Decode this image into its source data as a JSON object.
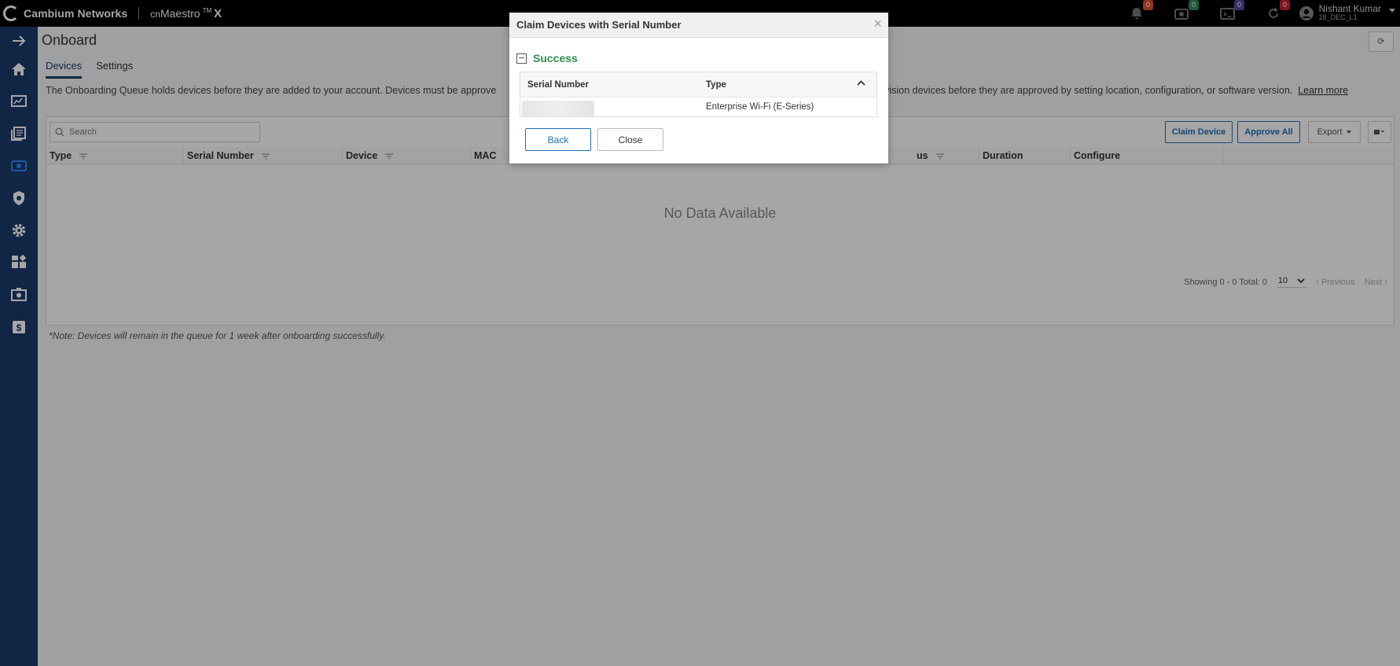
{
  "topbar": {
    "brand": "Cambium Networks",
    "product_prefix": "cn",
    "product_name": "Maestro",
    "product_tm": "TM",
    "product_suffix": "X",
    "badges": [
      {
        "icon": "alarm-bell-icon",
        "count": "0",
        "color": "#e0522e"
      },
      {
        "icon": "devices-icon",
        "count": "0",
        "color": "#2e8b57"
      },
      {
        "icon": "terminal-icon",
        "count": "0",
        "color": "#5b4aa8"
      },
      {
        "icon": "sync-icon",
        "count": "0",
        "color": "#c82333"
      }
    ],
    "user_name": "Nishant Kumar",
    "user_org": "18_DEC_L1"
  },
  "sidebar": {
    "items": [
      {
        "name": "expand-arrow",
        "icon": "arrow-right-icon"
      },
      {
        "name": "home",
        "icon": "home-icon"
      },
      {
        "name": "monitor",
        "icon": "monitor-chart-icon"
      },
      {
        "name": "inventory",
        "icon": "stack-icon"
      },
      {
        "name": "onboard",
        "icon": "onboard-icon",
        "active": true
      },
      {
        "name": "security",
        "icon": "shield-icon"
      },
      {
        "name": "settings",
        "icon": "gear-icon"
      },
      {
        "name": "apps",
        "icon": "apps-icon"
      },
      {
        "name": "services",
        "icon": "services-icon"
      },
      {
        "name": "billing",
        "icon": "dollar-icon"
      }
    ]
  },
  "page": {
    "title": "Onboard",
    "refresh_label": "⟳",
    "tabs": [
      {
        "label": "Devices",
        "active": true
      },
      {
        "label": "Settings",
        "active": false
      }
    ],
    "info_text_start": "The Onboarding Queue holds devices before they are added to your account. Devices must be approve",
    "info_text_end": "can pre-provision devices before they are approved by setting location, configuration, or software version.",
    "learn_more": "Learn more",
    "search_placeholder": "Search",
    "buttons": {
      "claim": "Claim Device",
      "approve_all": "Approve All",
      "export": "Export"
    },
    "columns": [
      "Type",
      "Serial Number",
      "Device",
      "MAC",
      "us",
      "Duration",
      "Configure"
    ],
    "empty_text": "No Data Available",
    "pager": {
      "showing": "Showing 0 - 0 Total: 0",
      "page_size": "10",
      "previous": "‹ Previous",
      "next": "Next ›"
    },
    "note": "*Note: Devices will remain in the queue for 1 week after onboarding successfully."
  },
  "modal": {
    "title": "Claim Devices with Serial Number",
    "close_symbol": "×",
    "status": "Success",
    "columns": [
      "Serial Number",
      "Type"
    ],
    "rows": [
      {
        "serial": "",
        "type": "Enterprise Wi-Fi (E-Series)"
      }
    ],
    "back_label": "Back",
    "close_label": "Close"
  }
}
